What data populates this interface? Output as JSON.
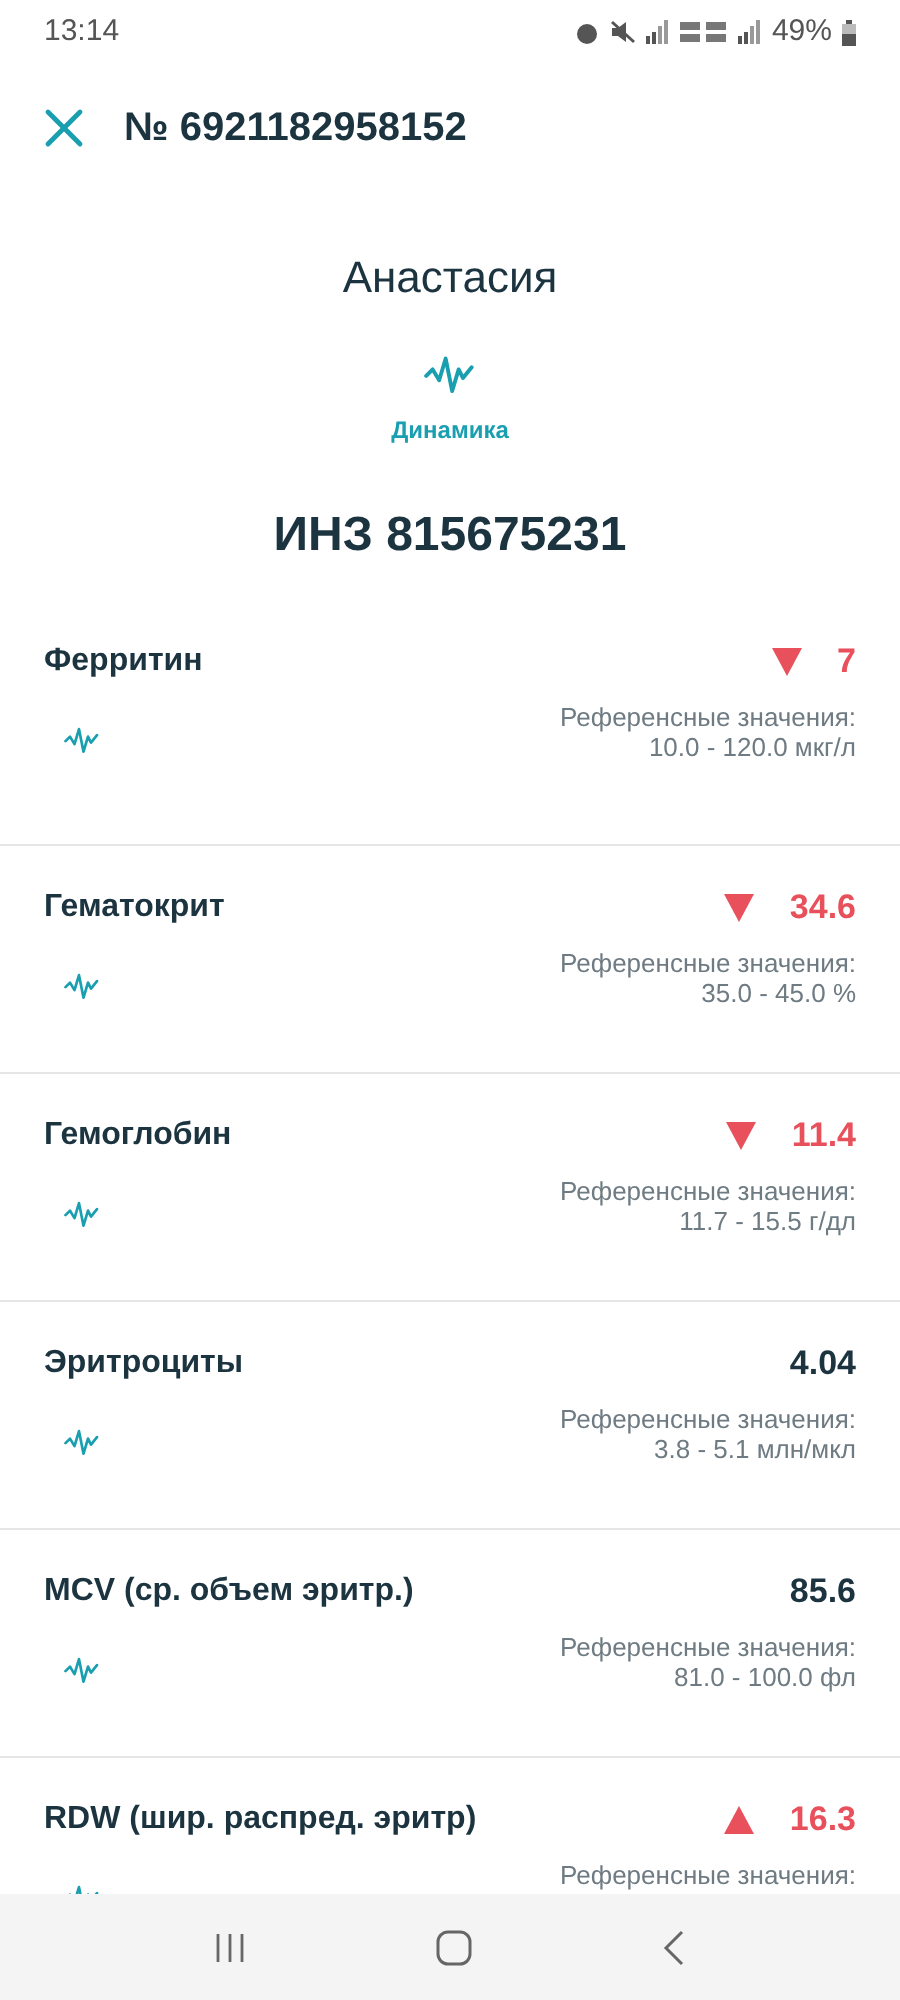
{
  "status_bar": {
    "time": "13:14",
    "battery": "49%"
  },
  "header": {
    "title": "№ 6921182958152"
  },
  "patient": {
    "name": "Анастасия",
    "dynamics_label": "Динамика",
    "id": "ИНЗ 815675231"
  },
  "results": [
    {
      "name": "Ферритин",
      "value": "7",
      "kind": "low",
      "reference_label": "Референсные значения:",
      "reference_range": "10.0 - 120.0 мкг/л"
    },
    {
      "name": "Гематокрит",
      "value": "34.6",
      "kind": "low",
      "reference_label": "Референсные значения:",
      "reference_range": "35.0 - 45.0 %"
    },
    {
      "name": "Гемоглобин",
      "value": "11.4",
      "kind": "low",
      "reference_label": "Референсные значения:",
      "reference_range": "11.7 - 15.5 г/дл"
    },
    {
      "name": "Эритроциты",
      "value": "4.04",
      "kind": "normal",
      "reference_label": "Референсные значения:",
      "reference_range": "3.8 - 5.1 млн/мкл"
    },
    {
      "name": "MCV (ср. объем эритр.)",
      "value": "85.6",
      "kind": "normal",
      "reference_label": "Референсные значения:",
      "reference_range": "81.0 - 100.0 фл"
    },
    {
      "name": "RDW (шир. распред. эритр)",
      "value": "16.3",
      "kind": "high",
      "reference_label": "Референсные значения:"
    }
  ]
}
